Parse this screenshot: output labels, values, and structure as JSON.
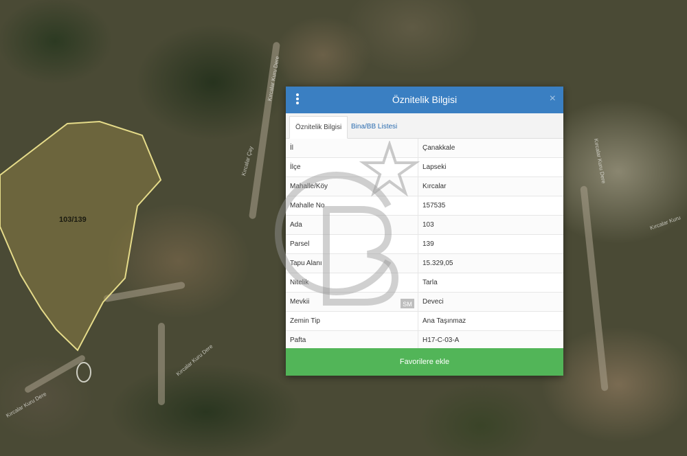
{
  "map": {
    "parcel_label": "103/139",
    "road_labels": [
      "Kırcalar Kuru Dere",
      "Kırcalar Çay",
      "Kırcalar Kuru Dere",
      "Kırcalar Kuru Dere",
      "Kırcalar Kuru",
      "Kırcalar Kuru Dere"
    ]
  },
  "dialog": {
    "title": "Öznitelik Bilgisi",
    "close_glyph": "×",
    "tabs": [
      {
        "label": "Öznitelik Bilgisi"
      },
      {
        "label": "Bina/BB Listesi"
      }
    ],
    "rows": [
      {
        "key": "İl",
        "value": "Çanakkale"
      },
      {
        "key": "İlçe",
        "value": "Lapseki"
      },
      {
        "key": "Mahalle/Köy",
        "value": "Kırcalar"
      },
      {
        "key": "Mahalle No",
        "value": "157535"
      },
      {
        "key": "Ada",
        "value": "103"
      },
      {
        "key": "Parsel",
        "value": "139"
      },
      {
        "key": "Tapu Alanı",
        "value": "15.329,05"
      },
      {
        "key": "Nitelik",
        "value": "Tarla"
      },
      {
        "key": "Mevkii",
        "value": "Deveci"
      },
      {
        "key": "Zemin Tip",
        "value": "Ana Taşınmaz"
      },
      {
        "key": "Pafta",
        "value": "H17-C-03-A"
      }
    ],
    "favorite_label": "Favorilere ekle"
  },
  "watermark": {
    "badge": "SM"
  },
  "colors": {
    "header": "#3a7fc2",
    "favorite": "#52b558",
    "tab_active": "#2c6db0",
    "parcel_outline": "#e6dc8a"
  }
}
